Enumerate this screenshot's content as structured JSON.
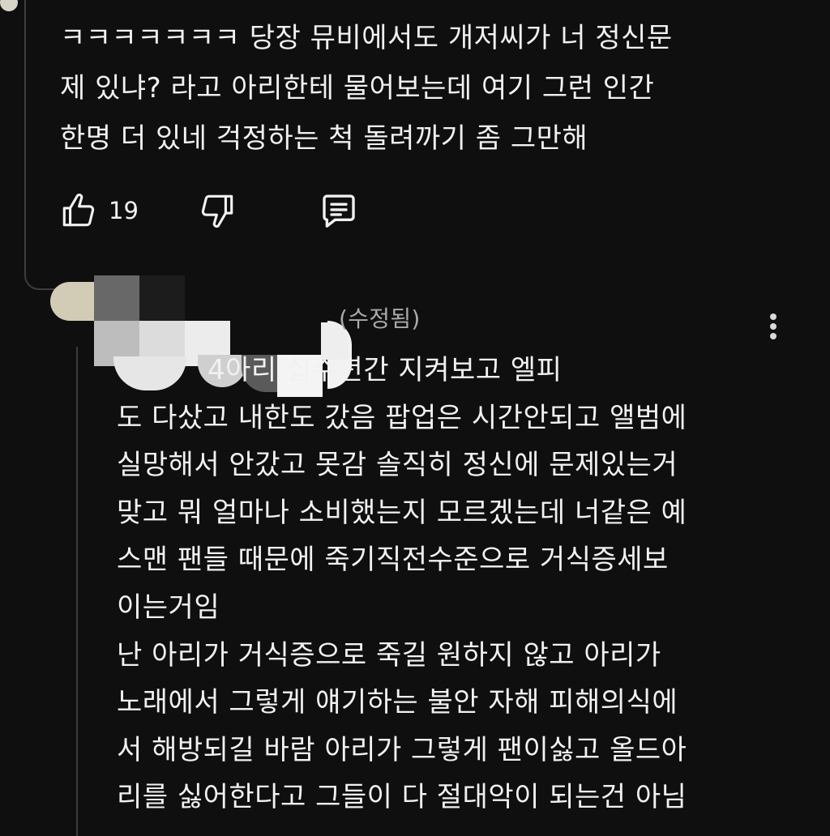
{
  "top_comment": {
    "lines": [
      "ㅋㅋㅋㅋㅋㅋㅋ 당장 뮤비에서도 개저씨가 너 정신문",
      "제 있냐? 라고 아리한테 물어보는데 여기 그런 인간",
      "한명 더 있네 걱정하는 척 돌려까기 좀 그만해"
    ],
    "like_count": "19",
    "icons": {
      "like": "thumbs-up-icon",
      "dislike": "thumbs-down-icon",
      "reply": "reply-comment-icon"
    }
  },
  "reply": {
    "meta": "(수정됨)",
    "meta_partial_char": "",
    "lines": [
      "4아리 십수년간 지켜보고 엘피",
      "도 다샀고 내한도 갔음 팝업은 시간안되고 앨범에",
      "실망해서 안갔고 못감 솔직히 정신에 문제있는거",
      "맞고 뭐 얼마나 소비했는지 모르겠는데 너같은 예",
      "스맨 팬들 때문에 죽기직전수준으로 거식증세보",
      "이는거임",
      "난 아리가 거식증으로 죽길 원하지 않고 아리가",
      "노래에서 그렇게 얘기하는 불안 자해 피해의식에",
      "서 해방되길 바람 아리가 그렇게 팬이싫고 올드아",
      "리를 싫어한다고 그들이 다 절대악이 되는건 아님"
    ],
    "menu_icon": "more-vertical-icon"
  },
  "colors": {
    "background": "#0f0f0f",
    "text": "#f1f1f1",
    "meta": "#aaaaaa",
    "thread_line": "#3d3d3d"
  }
}
